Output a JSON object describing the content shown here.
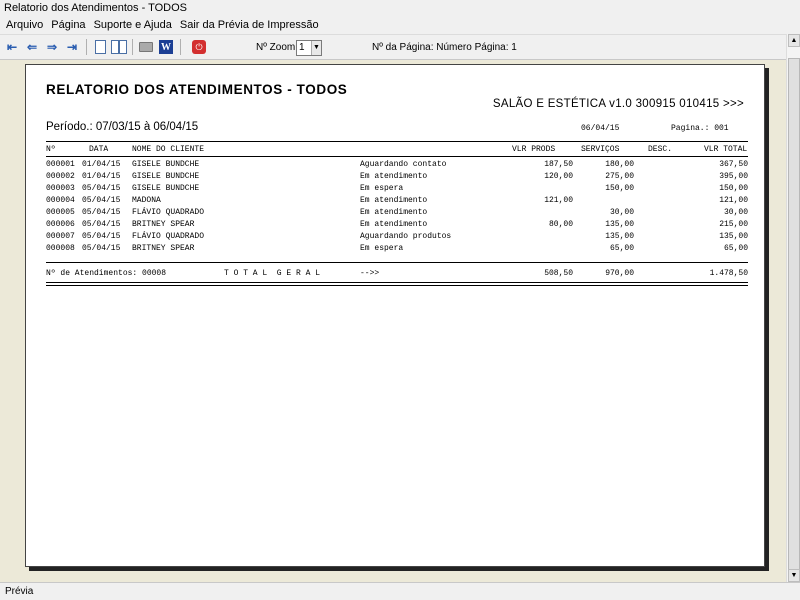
{
  "window": {
    "title": "Relatorio dos Atendimentos  - TODOS"
  },
  "menu": {
    "items": [
      "Arquivo",
      "Página",
      "Suporte e Ajuda",
      "Sair da Prévia de Impressão"
    ]
  },
  "toolbar": {
    "zoom_label": "Nº Zoom",
    "zoom_value": "1",
    "page_info": "Nº da Página: Número Página: 1"
  },
  "report": {
    "title": "RELATORIO DOS ATENDIMENTOS  - TODOS",
    "app": "SALÃO E ESTÉTICA v1.0 300915 010415 >>>",
    "period": "Período.: 07/03/15 à 06/04/15",
    "date": "06/04/15",
    "page": "Pagina.: 001",
    "headers": {
      "num": "Nº",
      "date": "DATA",
      "client": "NOME DO CLIENTE",
      "prods": "VLR PRODS",
      "services": "SERVIÇOS",
      "desc": "DESC.",
      "total": "VLR TOTAL"
    },
    "rows": [
      {
        "num": "000001",
        "date": "01/04/15",
        "client": "GISELE BUNDCHE",
        "status": "Aguardando contato",
        "prods": "187,50",
        "services": "180,00",
        "desc": "",
        "total": "367,50"
      },
      {
        "num": "000002",
        "date": "01/04/15",
        "client": "GISELE BUNDCHE",
        "status": "Em atendimento",
        "prods": "120,00",
        "services": "275,00",
        "desc": "",
        "total": "395,00"
      },
      {
        "num": "000003",
        "date": "05/04/15",
        "client": "GISELE BUNDCHE",
        "status": "Em espera",
        "prods": "",
        "services": "150,00",
        "desc": "",
        "total": "150,00"
      },
      {
        "num": "000004",
        "date": "05/04/15",
        "client": "MADONA",
        "status": "Em atendimento",
        "prods": "121,00",
        "services": "",
        "desc": "",
        "total": "121,00"
      },
      {
        "num": "000005",
        "date": "05/04/15",
        "client": "FLÁVIO QUADRADO",
        "status": "Em atendimento",
        "prods": "",
        "services": "30,00",
        "desc": "",
        "total": "30,00"
      },
      {
        "num": "000006",
        "date": "05/04/15",
        "client": "BRITNEY SPEAR",
        "status": "Em atendimento",
        "prods": "80,00",
        "services": "135,00",
        "desc": "",
        "total": "215,00"
      },
      {
        "num": "000007",
        "date": "05/04/15",
        "client": "FLÁVIO QUADRADO",
        "status": "Aguardando produtos",
        "prods": "",
        "services": "135,00",
        "desc": "",
        "total": "135,00"
      },
      {
        "num": "000008",
        "date": "05/04/15",
        "client": "BRITNEY SPEAR",
        "status": "Em espera",
        "prods": "",
        "services": "65,00",
        "desc": "",
        "total": "65,00"
      }
    ],
    "totals": {
      "count_label": "Nº de Atendimentos: 00008",
      "grand_label": "T O T A L  G E R A L",
      "arrow": "-->>",
      "prods": "508,50",
      "services": "970,00",
      "total": "1.478,50"
    }
  },
  "status": {
    "text": "Prévia"
  },
  "icons": [
    "first-page-icon",
    "prev-page-icon",
    "next-page-icon",
    "last-page-icon",
    "single-page-icon",
    "two-pages-icon",
    "print-icon",
    "word-export-icon",
    "close-preview-icon"
  ]
}
